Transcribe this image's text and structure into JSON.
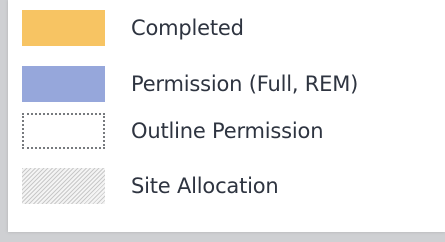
{
  "legend": {
    "items": [
      {
        "label": "Completed",
        "fill": "#f7c463",
        "pattern": "solid"
      },
      {
        "label": "Permission (Full, REM)",
        "fill": "#96a7db",
        "pattern": "solid"
      },
      {
        "label": "Outline Permission",
        "fill": "#ffffff",
        "pattern": "dotted-outline"
      },
      {
        "label": "Site Allocation",
        "fill": "#f2f2f2",
        "pattern": "diagonal-hatch"
      }
    ]
  }
}
